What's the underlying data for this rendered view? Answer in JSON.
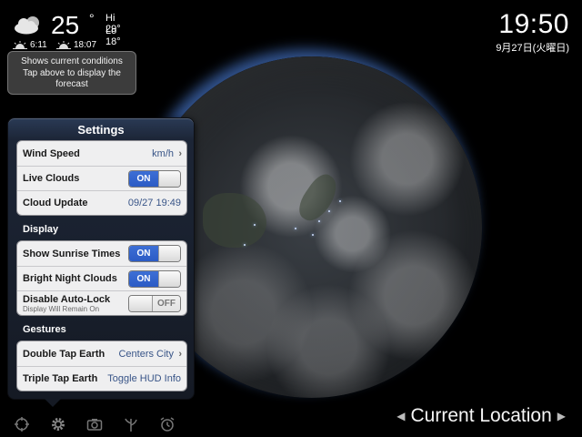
{
  "weather": {
    "temp": "25",
    "degree": "°",
    "hi": "Hi 29°",
    "lo": "Lo 18°",
    "sunrise": "6:11",
    "sunset": "18:07",
    "icon": "partly-cloudy-icon",
    "tooltip_line1": "Shows current conditions",
    "tooltip_line2": "Tap above to display the",
    "tooltip_line3": "forecast"
  },
  "clock": {
    "time": "19:50",
    "date": "9月27日(火曜日)"
  },
  "settings": {
    "title": "Settings",
    "rows1": [
      {
        "label": "Wind Speed",
        "value": "km/h"
      },
      {
        "label": "Live Clouds",
        "toggle": "ON"
      },
      {
        "label": "Cloud Update",
        "value": "09/27 19:49"
      }
    ],
    "display_header": "Display",
    "rows2": [
      {
        "label": "Show Sunrise Times",
        "toggle": "ON"
      },
      {
        "label": "Bright Night Clouds",
        "toggle": "ON"
      },
      {
        "label": "Disable Auto-Lock",
        "sub": "Display Will Remain On",
        "toggle": "OFF"
      }
    ],
    "gestures_header": "Gestures",
    "rows3": [
      {
        "label": "Double Tap Earth",
        "value": "Centers City"
      },
      {
        "label": "Triple Tap Earth",
        "value": "Toggle HUD Info"
      }
    ]
  },
  "toolbar": {
    "icons": [
      "crosshair-icon",
      "gear-icon",
      "camera-icon",
      "plant-icon",
      "alarm-clock-icon"
    ]
  },
  "location": {
    "label": "Current Location"
  },
  "colors": {
    "toggle_on": "#2c5bc5",
    "value_text": "#385487",
    "atmosphere": "#5a96ff"
  }
}
